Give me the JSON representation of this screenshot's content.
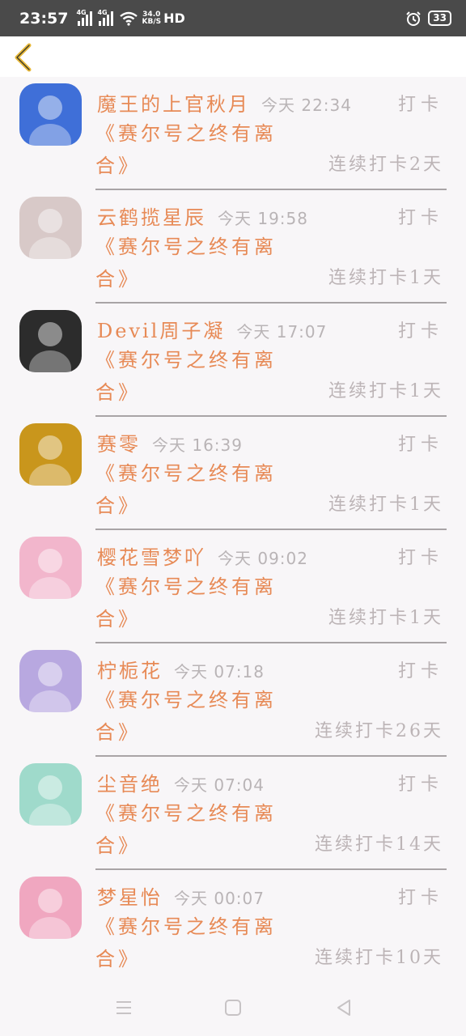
{
  "status_bar": {
    "time": "23:57",
    "sim1_label": "4G",
    "sim2_label": "4G",
    "speed_value": "34.0",
    "speed_unit": "KB/S",
    "hd_label": "HD",
    "battery": "33",
    "icons": [
      "signal-icon",
      "wifi-icon",
      "alarm-icon",
      "battery-icon"
    ]
  },
  "header": {
    "back_icon": "chevron-left-icon",
    "accent_color": "#e8b93a"
  },
  "colors": {
    "name": "#e78a56",
    "muted": "#bcb4b6",
    "divider": "#a9a4a6"
  },
  "items": [
    {
      "name": "魔王的上官秋月",
      "time": "今天 22:34",
      "action": "打卡",
      "book": "《赛尔号之终有离合》",
      "streak": "连续打卡2天",
      "avatar_color": "#3f6fd8"
    },
    {
      "name": "云鹤揽星辰",
      "time": "今天 19:58",
      "action": "打卡",
      "book": "《赛尔号之终有离合》",
      "streak": "连续打卡1天",
      "avatar_color": "#d8c9c8"
    },
    {
      "name": "Devil周子凝",
      "time": "今天 17:07",
      "action": "打卡",
      "book": "《赛尔号之终有离合》",
      "streak": "连续打卡1天",
      "avatar_color": "#2c2c2c"
    },
    {
      "name": "赛零",
      "time": "今天 16:39",
      "action": "打卡",
      "book": "《赛尔号之终有离合》",
      "streak": "连续打卡1天",
      "avatar_color": "#c9961c"
    },
    {
      "name": "樱花雪梦吖",
      "time": "今天 09:02",
      "action": "打卡",
      "book": "《赛尔号之终有离合》",
      "streak": "连续打卡1天",
      "avatar_color": "#f2b6cc"
    },
    {
      "name": "柠栀花",
      "time": "今天 07:18",
      "action": "打卡",
      "book": "《赛尔号之终有离合》",
      "streak": "连续打卡26天",
      "avatar_color": "#b8a8e0"
    },
    {
      "name": "尘音绝",
      "time": "今天 07:04",
      "action": "打卡",
      "book": "《赛尔号之终有离合》",
      "streak": "连续打卡14天",
      "avatar_color": "#9fdacb"
    },
    {
      "name": "梦星怡",
      "time": "今天 00:07",
      "action": "打卡",
      "book": "《赛尔号之终有离合》",
      "streak": "连续打卡10天",
      "avatar_color": "#f0a7c0"
    }
  ],
  "nav_bar": {
    "icons": [
      "menu-icon",
      "home-icon",
      "back-triangle-icon"
    ]
  }
}
